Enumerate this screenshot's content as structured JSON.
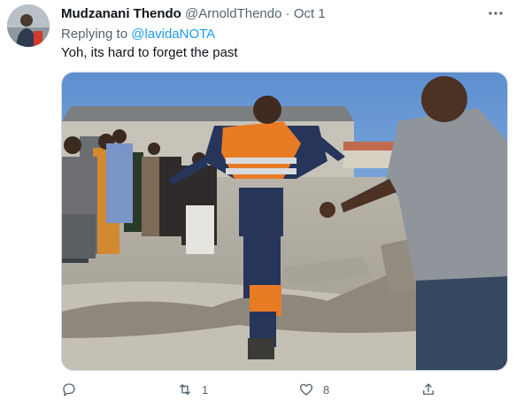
{
  "tweet": {
    "author_name": "Mudzanani Thendo",
    "author_handle": "@ArnoldThendo",
    "separator": "·",
    "date": "Oct 1",
    "replying_prefix": "Replying to",
    "replying_to": "@lavidaNOTA",
    "text": "Yoh, its hard to forget the past",
    "stats": {
      "replies": "",
      "retweets": "1",
      "likes": "8"
    }
  },
  "icons": {
    "more": "more-dots-icon",
    "reply": "reply-bubble-icon",
    "retweet": "retweet-icon",
    "like": "heart-icon",
    "share": "share-icon"
  },
  "colors": {
    "link": "#1d9bf0",
    "secondary_text": "#536471",
    "primary_text": "#0f1419"
  }
}
